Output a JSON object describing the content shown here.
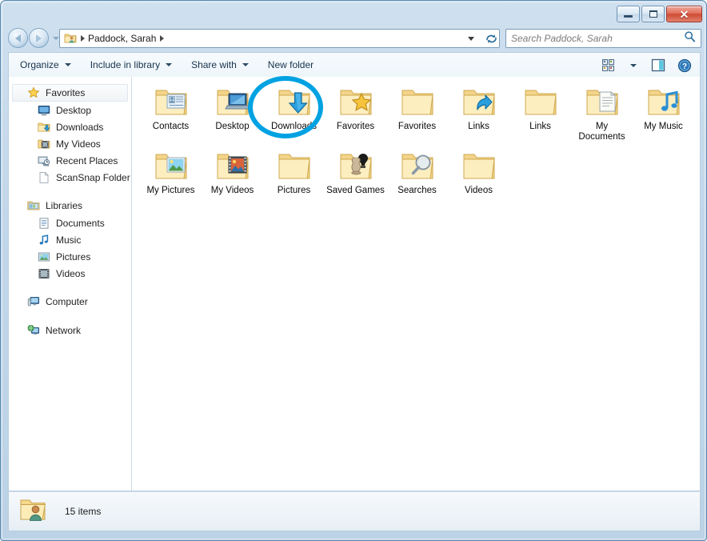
{
  "window": {
    "controls": {
      "minimize": "Minimize",
      "maximize": "Maximize",
      "close": "Close"
    }
  },
  "addressbar": {
    "back_label": "Back",
    "forward_label": "Forward",
    "recent_pages_label": "Recent Pages",
    "breadcrumb": "Paddock, Sarah",
    "refresh_label": "Refresh",
    "dropdown_label": "Previous Locations"
  },
  "search": {
    "placeholder": "Search Paddock, Sarah",
    "value": "",
    "icon": "search-icon"
  },
  "toolbar": {
    "items": [
      {
        "label": "Organize",
        "has_caret": true
      },
      {
        "label": "Include in library",
        "has_caret": true
      },
      {
        "label": "Share with",
        "has_caret": true
      },
      {
        "label": "New folder",
        "has_caret": false
      }
    ],
    "view_label": "Change your view",
    "view_caret_label": "More options",
    "preview_label": "Show the preview pane",
    "help_label": "Get help"
  },
  "sidebar": {
    "groups": [
      {
        "header": {
          "label": "Favorites",
          "icon": "star-icon",
          "selected": true
        },
        "items": [
          {
            "label": "Desktop",
            "icon": "desktop-icon"
          },
          {
            "label": "Downloads",
            "icon": "downloads-folder-icon"
          },
          {
            "label": "My Videos",
            "icon": "videos-folder-icon"
          },
          {
            "label": "Recent Places",
            "icon": "recent-places-icon"
          },
          {
            "label": "ScanSnap Folder",
            "icon": "document-icon"
          }
        ]
      },
      {
        "header": {
          "label": "Libraries",
          "icon": "libraries-icon",
          "selected": false
        },
        "items": [
          {
            "label": "Documents",
            "icon": "documents-library-icon"
          },
          {
            "label": "Music",
            "icon": "music-note-icon"
          },
          {
            "label": "Pictures",
            "icon": "pictures-library-icon"
          },
          {
            "label": "Videos",
            "icon": "videos-library-icon"
          }
        ]
      },
      {
        "header": {
          "label": "Computer",
          "icon": "computer-icon",
          "selected": false
        },
        "items": []
      },
      {
        "header": {
          "label": "Network",
          "icon": "network-icon",
          "selected": false
        },
        "items": []
      }
    ]
  },
  "content": {
    "items": [
      {
        "label": "Contacts",
        "icon": "contacts-folder-icon",
        "annotated": false
      },
      {
        "label": "Desktop",
        "icon": "desktop-folder-icon",
        "annotated": false
      },
      {
        "label": "Downloads",
        "icon": "downloads-folder-icon",
        "annotated": true
      },
      {
        "label": "Favorites",
        "icon": "favorites-star-folder-icon",
        "annotated": false
      },
      {
        "label": "Favorites",
        "icon": "plain-folder-icon",
        "annotated": false
      },
      {
        "label": "Links",
        "icon": "links-shortcut-folder-icon",
        "annotated": false
      },
      {
        "label": "Links",
        "icon": "plain-folder-icon",
        "annotated": false
      },
      {
        "label": "My Documents",
        "icon": "my-documents-folder-icon",
        "annotated": false
      },
      {
        "label": "My Music",
        "icon": "my-music-folder-icon",
        "annotated": false
      },
      {
        "label": "My Pictures",
        "icon": "my-pictures-folder-icon",
        "annotated": false
      },
      {
        "label": "My Videos",
        "icon": "my-videos-folder-icon",
        "annotated": false
      },
      {
        "label": "Pictures",
        "icon": "plain-folder-icon",
        "annotated": false
      },
      {
        "label": "Saved Games",
        "icon": "saved-games-folder-icon",
        "annotated": false
      },
      {
        "label": "Searches",
        "icon": "searches-folder-icon",
        "annotated": false
      },
      {
        "label": "Videos",
        "icon": "plain-folder-icon",
        "annotated": false
      }
    ]
  },
  "statusbar": {
    "icon": "user-folder-icon",
    "text": "15 items"
  },
  "colors": {
    "annotation": "#00a2e2",
    "folder_body": "#fbe3a0",
    "folder_edge": "#d8b45c",
    "title_bar": "#c3d7ea",
    "close_button": "#cf4a33"
  }
}
